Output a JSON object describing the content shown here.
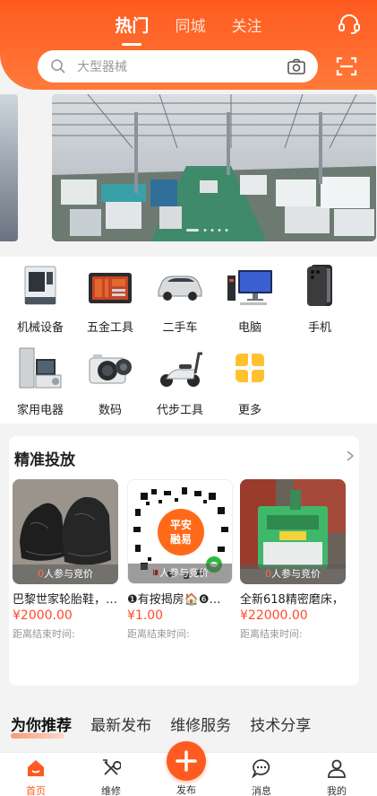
{
  "header": {
    "tabs": [
      {
        "label": "热门",
        "active": true
      },
      {
        "label": "同城",
        "active": false
      },
      {
        "label": "关注",
        "active": false
      }
    ],
    "search_placeholder": "大型器械"
  },
  "categories": [
    {
      "label": "机械设备",
      "icon": "machine-icon"
    },
    {
      "label": "五金工具",
      "icon": "toolbox-icon"
    },
    {
      "label": "二手车",
      "icon": "car-icon"
    },
    {
      "label": "电脑",
      "icon": "computer-icon"
    },
    {
      "label": "手机",
      "icon": "phone-icon"
    },
    {
      "label": "家用电器",
      "icon": "appliance-icon"
    },
    {
      "label": "数码",
      "icon": "camera-icon"
    },
    {
      "label": "代步工具",
      "icon": "scooter-icon"
    },
    {
      "label": "更多",
      "icon": "more-icon"
    }
  ],
  "precise": {
    "title": "精准投放",
    "items": [
      {
        "bid_count": "0",
        "bid_suffix": "人参与竞价",
        "name": "巴黎世家轮胎鞋，…",
        "price": "¥2000.00",
        "end_label": "距离结束时间:"
      },
      {
        "bid_count": "0",
        "bid_suffix": "人参与竞价",
        "name": "❶有按揭房🏠❻…",
        "price": "¥1.00",
        "end_label": "距离结束时间:",
        "qr_text_top": "平安",
        "qr_text_bottom": "融易"
      },
      {
        "bid_count": "0",
        "bid_suffix": "人参与竞价",
        "name": "全新618精密磨床，",
        "price": "¥22000.00",
        "end_label": "距离结束时间:"
      }
    ]
  },
  "recommend_tabs": [
    {
      "label": "为你推荐",
      "active": true
    },
    {
      "label": "最新发布",
      "active": false
    },
    {
      "label": "维修服务",
      "active": false
    },
    {
      "label": "技术分享",
      "active": false
    }
  ],
  "nav": [
    {
      "label": "首页",
      "icon": "home-icon",
      "active": true
    },
    {
      "label": "维修",
      "icon": "wrench-icon",
      "active": false
    },
    {
      "label": "发布",
      "icon": "plus-icon",
      "active": false
    },
    {
      "label": "消息",
      "icon": "message-icon",
      "active": false
    },
    {
      "label": "我的",
      "icon": "user-icon",
      "active": false
    }
  ],
  "colors": {
    "accent": "#ff5a1f",
    "price": "#ff4a2a"
  }
}
